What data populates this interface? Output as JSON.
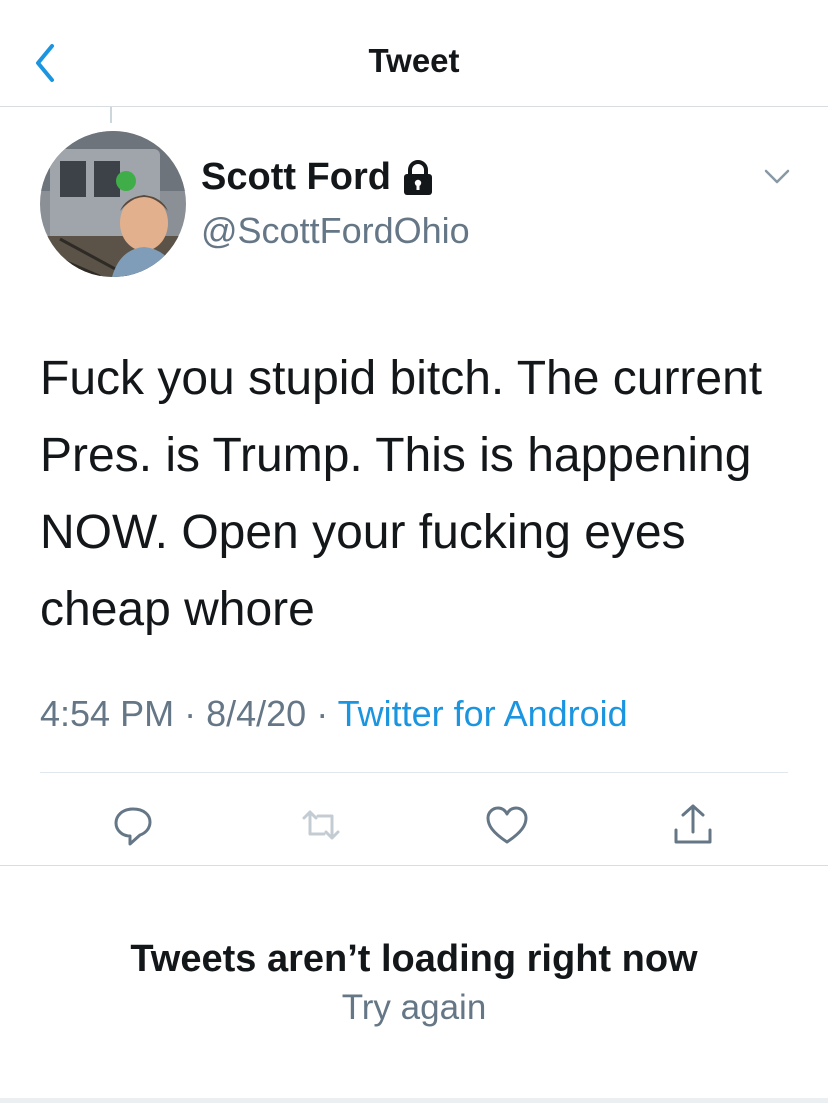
{
  "header": {
    "title": "Tweet",
    "back_icon": "chevron-left-icon"
  },
  "author": {
    "name": "Scott Ford",
    "handle": "@ScottFordOhio",
    "protected_icon": "lock-icon"
  },
  "tweet": {
    "text": "Fuck you stupid bitch. The current Pres. is Trump. This is happening NOW. Open your fucking eyes cheap whore",
    "time": "4:54 PM",
    "sep1": "·",
    "date": "8/4/20",
    "sep2": "·",
    "source": "Twitter for Android"
  },
  "actions": [
    "reply-icon",
    "retweet-icon",
    "like-icon",
    "share-icon"
  ],
  "error": {
    "title": "Tweets aren’t loading right now",
    "retry": "Try again"
  },
  "colors": {
    "accent": "#1b95e0",
    "secondary_text": "#657786",
    "primary_text": "#14171a"
  }
}
